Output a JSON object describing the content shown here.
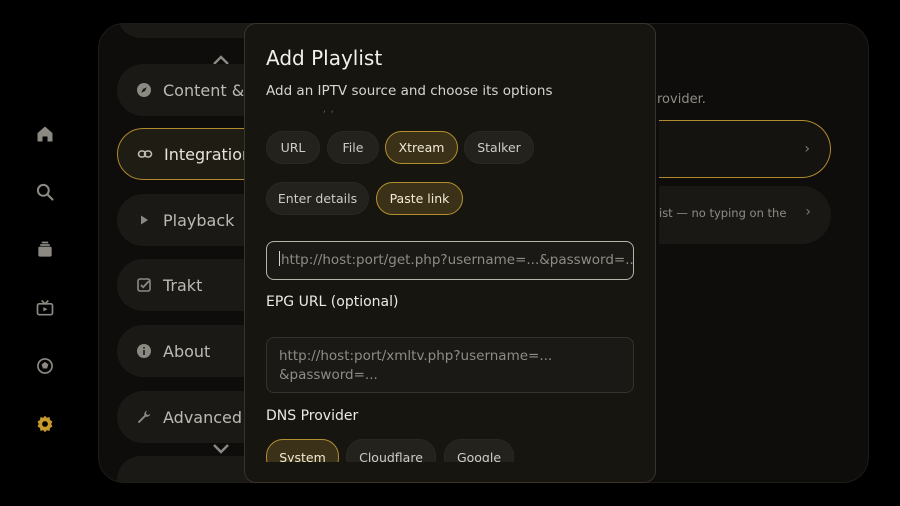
{
  "rail": {
    "icons": [
      "home-icon",
      "search-icon",
      "library-icon",
      "tv-icon",
      "sports-icon",
      "settings-icon"
    ],
    "accent": "#c79a2b"
  },
  "settings_menu": {
    "items": [
      {
        "label": "Content & Discovery",
        "icon": "compass-icon"
      },
      {
        "label": "Integrations",
        "icon": "link-icon",
        "active": true
      },
      {
        "label": "Playback",
        "icon": "play-icon"
      },
      {
        "label": "Trakt",
        "icon": "check-square-icon"
      },
      {
        "label": "About",
        "icon": "info-icon"
      },
      {
        "label": "Advanced",
        "icon": "wrench-icon"
      }
    ]
  },
  "right_panel": {
    "desc_fragment": "rovider.",
    "card_b_fragment": "ist — no typing on the"
  },
  "modal": {
    "title": "Add Playlist",
    "subtitle": "Add an IPTV source and choose its options",
    "source_types": [
      "URL",
      "File",
      "Xtream",
      "Stalker"
    ],
    "selected_source": "Xtream",
    "input_modes": [
      "Enter details",
      "Paste link"
    ],
    "selected_mode": "Paste link",
    "link_placeholder": "http://host:port/get.php?username=...&password=...",
    "epg_label": "EPG URL (optional)",
    "epg_placeholder_line1": "http://host:port/xmltv.php?username=...",
    "epg_placeholder_line2": "&password=...",
    "dns_label": "DNS Provider",
    "dns_options": [
      "System",
      "Cloudflare",
      "Google"
    ],
    "selected_dns": "System"
  }
}
